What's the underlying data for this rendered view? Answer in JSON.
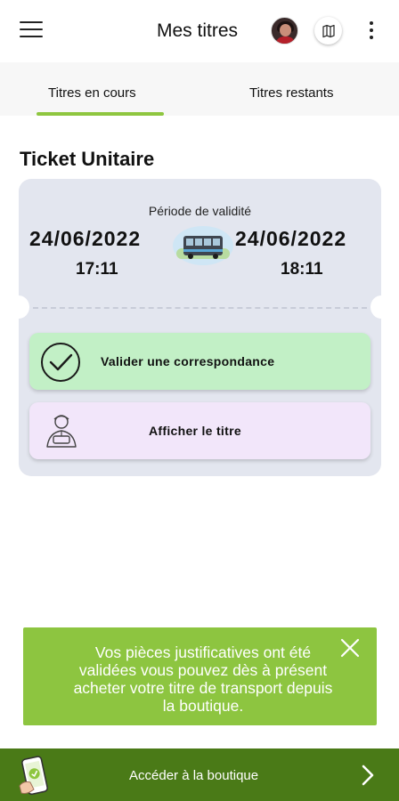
{
  "app_bar": {
    "title": "Mes titres",
    "menu_icon": "hamburger-menu-icon",
    "map_icon": "map-icon",
    "more_icon": "more-vertical-icon"
  },
  "tabs": [
    {
      "label": "Titres en cours",
      "active": true
    },
    {
      "label": "Titres restants",
      "active": false
    }
  ],
  "ticket": {
    "name": "Ticket Unitaire",
    "period_label": "Période de validité",
    "start_date": "24/06/2022",
    "start_time": "17:11",
    "end_date": "24/06/2022",
    "end_time": "18:11",
    "vehicle_icon": "bus-icon"
  },
  "actions": {
    "validate_label": "Valider une correspondance",
    "validate_icon": "check-circle-icon",
    "show_label": "Afficher le titre",
    "show_icon": "controller-agent-icon"
  },
  "toast": {
    "message": "Vos pièces justificatives ont été validées vous pouvez dès à présent acheter votre titre de transport depuis la boutique.",
    "close_icon": "close-icon"
  },
  "shop_bar": {
    "label": "Accéder à la boutique",
    "icon": "phone-shop-icon",
    "chevron_icon": "chevron-right-icon"
  },
  "colors": {
    "accent_green": "#8ec63f",
    "toast_bg": "#8dc540",
    "shop_bar_bg": "#4a7a17",
    "validate_bg": "#c2f0c6",
    "show_bg": "#f2e6fa",
    "card_bg": "#e3e6ef"
  }
}
